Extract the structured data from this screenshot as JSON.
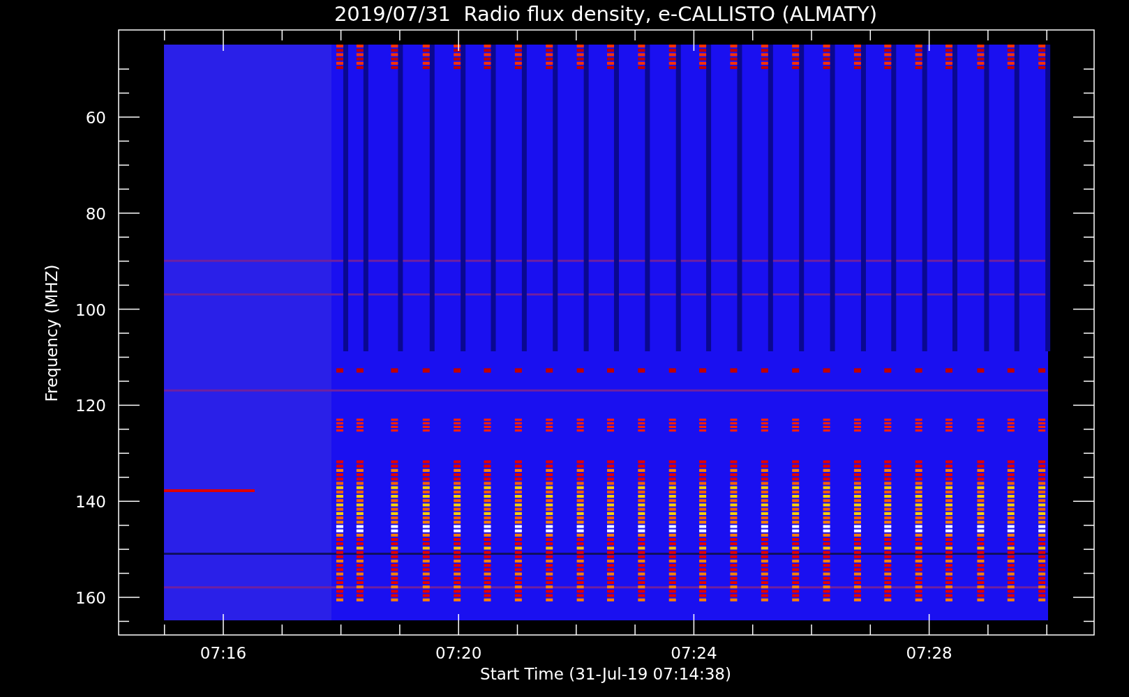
{
  "title": "2019/07/31  Radio flux density, e-CALLISTO (ALMATY)",
  "y_axis": {
    "label": "Frequency (MHZ)",
    "ticks": [
      "60",
      "80",
      "100",
      "120",
      "140",
      "160"
    ]
  },
  "x_axis": {
    "label": "Start Time (31-Jul-19 07:14:38)",
    "ticks": [
      "07:16",
      "07:20",
      "07:24",
      "07:28"
    ]
  }
}
